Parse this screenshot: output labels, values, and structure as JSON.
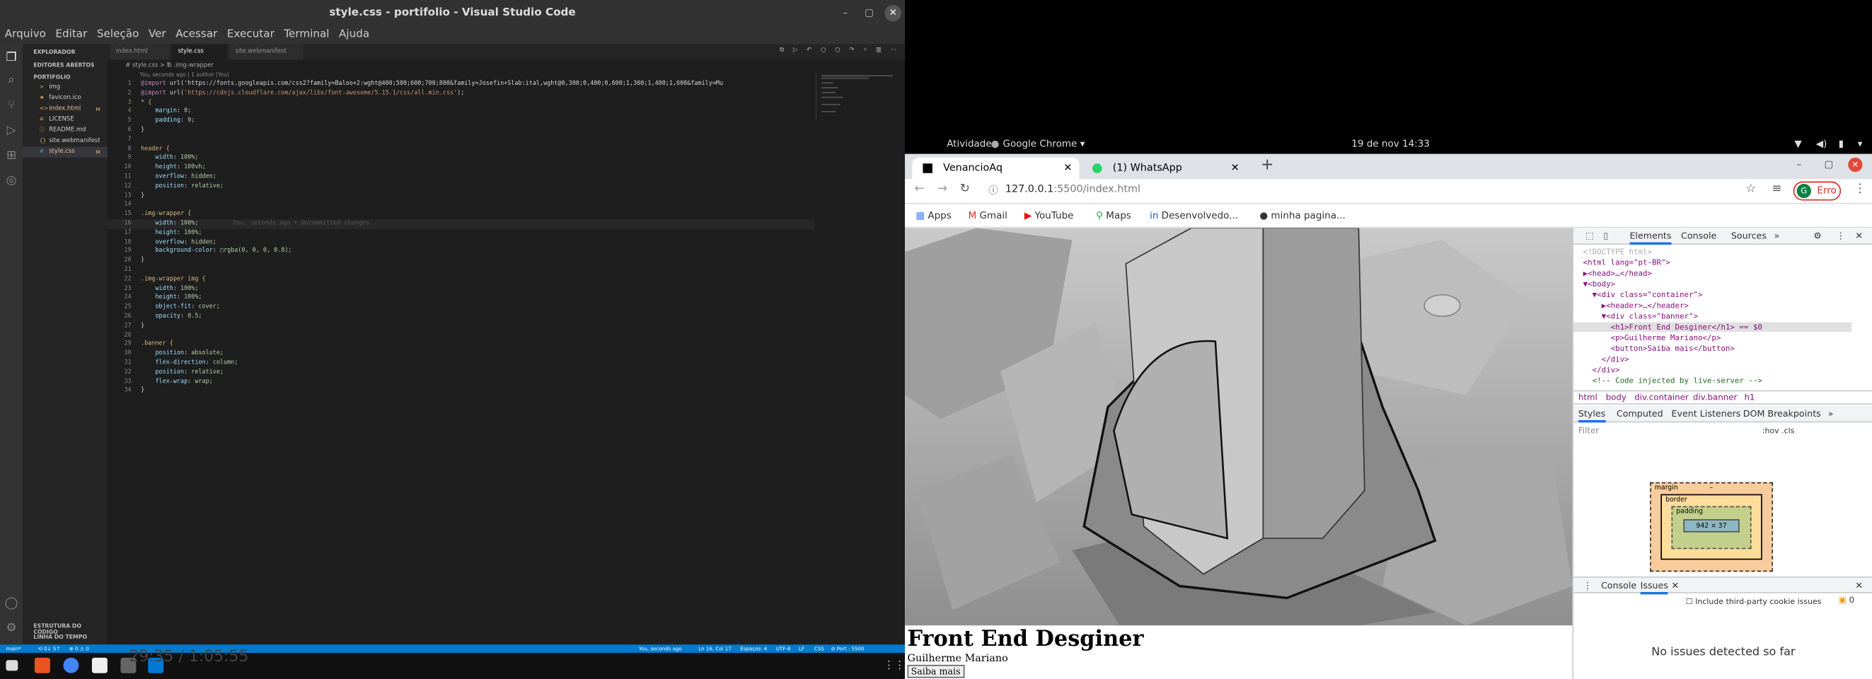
{
  "vscode": {
    "title": "style.css - portifolio - Visual Studio Code",
    "menu": [
      "Arquivo",
      "Editar",
      "Seleção",
      "Ver",
      "Acessar",
      "Executar",
      "Terminal",
      "Ajuda"
    ],
    "sidebar": {
      "explorer": "EXPLORADOR",
      "open_editors": "EDITORES ABERTOS",
      "project": "PORTIFOLIO",
      "files": [
        {
          "name": "img",
          "icon": ">",
          "git": ""
        },
        {
          "name": "favicon.ico",
          "icon": "★",
          "git": ""
        },
        {
          "name": "index.html",
          "icon": "<>",
          "git": "M"
        },
        {
          "name": "LICENSE",
          "icon": "≡",
          "git": ""
        },
        {
          "name": "README.md",
          "icon": "ⓘ",
          "git": ""
        },
        {
          "name": "site.webmanifest",
          "icon": "{}",
          "git": ""
        },
        {
          "name": "style.css",
          "icon": "#",
          "git": "M"
        }
      ],
      "outline": "ESTRUTURA DO CÓDIGO",
      "timeline": "LINHA DO TEMPO"
    },
    "tabs": [
      "index.html",
      "style.css",
      "site.webmanifest"
    ],
    "breadcrumb": "# style.css > ℔ .img-wrapper",
    "blame": "You, seconds ago | 1 author (You)",
    "inline_blame": "You, seconds ago • Uncommitted changes",
    "code": [
      "@import url('https://fonts.googleapis.com/css2?family=Baloo+2:wght@400;500;600;700;800&family=Josefin+Slab:ital,wght@0,300;0,400;0,600;1,300;1,400;1,600&family=Mu",
      "@import url('https://cdnjs.cloudflare.com/ajax/libs/font-awesome/5.15.1/css/all.min.css');",
      "* {",
      "    margin: 0;",
      "    padding: 0;",
      "}",
      "",
      "header {",
      "    width: 100%;",
      "    height: 100vh;",
      "    overflow: hidden;",
      "    position: relative;",
      "}",
      "",
      ".img-wrapper {",
      "    width: 100%;",
      "    height: 100%;",
      "    overflow: hidden;",
      "    background-color: ▢rgba(0, 0, 0, 0.8);",
      "}",
      "",
      ".img-wrapper img {",
      "    width: 100%;",
      "    height: 100%;",
      "    object-fit: cover;",
      "    opacity: 0.5;",
      "}",
      "",
      ".banner {",
      "    position: absolute;",
      "    flex-direction: column;",
      "    position: relative;",
      "    flex-wrap: wrap;",
      "}"
    ],
    "status": {
      "branch": "main*",
      "sync": "⟲ 0↓ 5↑",
      "problems": "⊗ 0 ⚠ 0",
      "blame": "You, seconds ago",
      "cursor": "Ln 16, Col 17",
      "spaces": "Espaços: 4",
      "encoding": "UTF-8",
      "eol": "LF",
      "lang": "CSS",
      "port": "⊘ Port : 5500"
    },
    "video_time": "29:35 / 1:05:55"
  },
  "gnome": {
    "activities": "Atividades",
    "app": "Google Chrome ▾",
    "clock": "19 de nov  14:33"
  },
  "chrome": {
    "tabs": [
      "VenancioAq",
      "(1) WhatsApp"
    ],
    "url": "127.0.0.1:5500/index.html",
    "url_host": "127.0.0.1",
    "url_rest": ":5500/index.html",
    "profile": "G",
    "error": "Erro",
    "bookmarks": [
      "Apps",
      "Gmail",
      "YouTube",
      "Maps",
      "Desenvolvedo...",
      "minha pagina..."
    ]
  },
  "page": {
    "h1": "Front End Desginer",
    "p": "Guilherme Mariano",
    "button": "Saiba mais"
  },
  "devtools": {
    "tabs": [
      "Elements",
      "Console",
      "Sources"
    ],
    "dom": [
      "<!DOCTYPE html>",
      "<html lang=\"pt-BR\">",
      "▶<head>…</head>",
      "▼<body>",
      "  ▼<div class=\"container\">",
      "    ▶<header>…</header>",
      "    ▼<div class=\"banner\">",
      "      <h1>Front End Desginer</h1> == $0",
      "      <p>Guilherme Mariano</p>",
      "      <button>Saiba mais</button>",
      "    </div>",
      "  </div>",
      "  <!-- Code injected by live-server -->"
    ],
    "crumbs": [
      "html",
      "body",
      "div.container",
      "div.banner",
      "h1"
    ],
    "style_tabs": [
      "Styles",
      "Computed",
      "Event Listeners",
      "DOM Breakpoints"
    ],
    "filter": "Filter",
    "hov": ":hov  .cls",
    "box": {
      "margin": "margin",
      "border": "border",
      "padding": "padding",
      "size": "942 × 37",
      "dash": "–"
    },
    "drawer_tabs": [
      "Console",
      "Issues"
    ],
    "third_party": "Include third-party cookie issues",
    "issues_count": "0",
    "no_issues": "No issues detected so far"
  }
}
